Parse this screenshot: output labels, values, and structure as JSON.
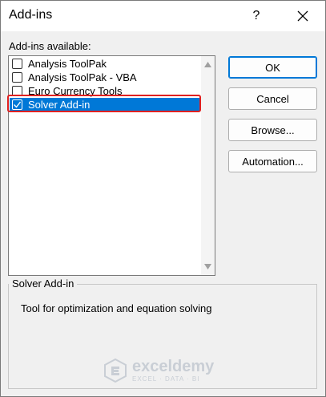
{
  "dialog": {
    "title": "Add-ins",
    "help_label": "?"
  },
  "list": {
    "label": "Add-ins available:",
    "items": [
      {
        "label": "Analysis ToolPak",
        "checked": false,
        "selected": false
      },
      {
        "label": "Analysis ToolPak - VBA",
        "checked": false,
        "selected": false
      },
      {
        "label": "Euro Currency Tools",
        "checked": false,
        "selected": false
      },
      {
        "label": "Solver Add-in",
        "checked": true,
        "selected": true
      }
    ]
  },
  "buttons": {
    "ok": "OK",
    "cancel": "Cancel",
    "browse": "Browse...",
    "automation": "Automation..."
  },
  "details": {
    "title": "Solver Add-in",
    "description": "Tool for optimization and equation solving"
  },
  "watermark": {
    "brand": "exceldemy",
    "tagline": "EXCEL · DATA · BI"
  },
  "colors": {
    "selection": "#0078d7",
    "highlight_border": "#e02020"
  }
}
